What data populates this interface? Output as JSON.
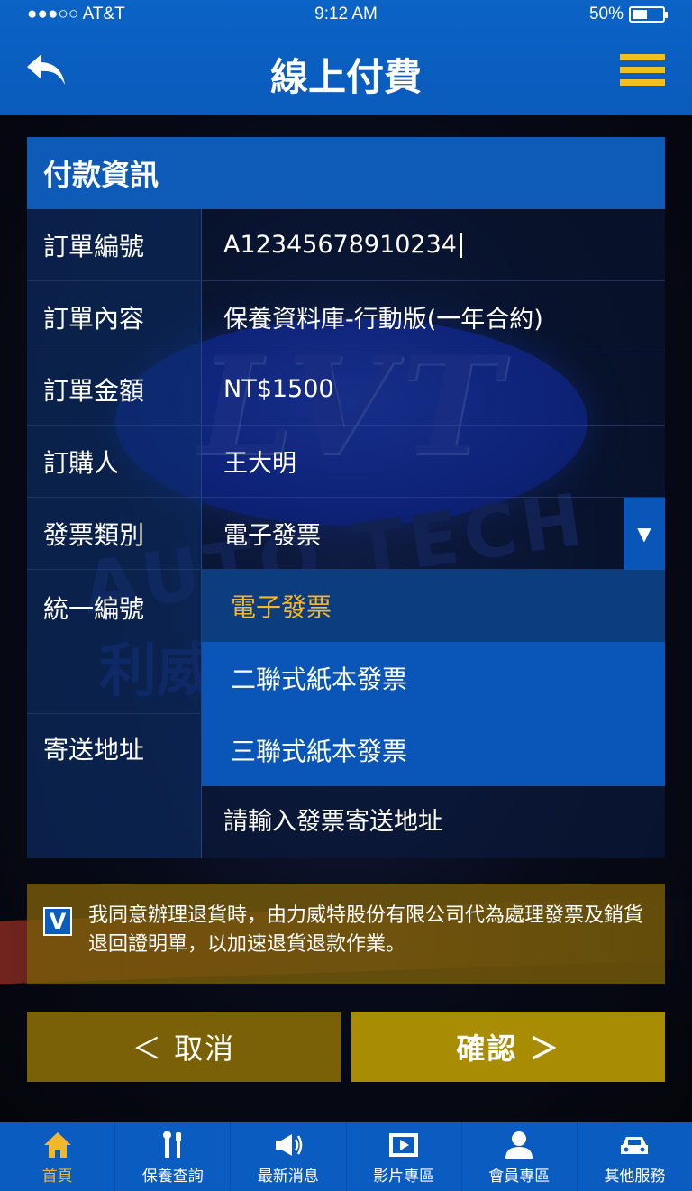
{
  "status_bar": {
    "carrier": "●●●○○ AT&T",
    "time": "9:12 AM",
    "battery": "50%",
    "battery_level": 0.5
  },
  "header": {
    "title": "線上付費",
    "back_icon": "back-arrow-icon",
    "menu_icon": "hamburger-menu-icon"
  },
  "panel": {
    "title": "付款資訊",
    "rows": [
      {
        "label": "訂單編號",
        "value": "A12345678910234"
      },
      {
        "label": "訂單內容",
        "value": "保養資料庫-行動版(一年合約)"
      },
      {
        "label": "訂單金額",
        "value": "NT$1500"
      },
      {
        "label": "訂購人",
        "value": "王大明"
      },
      {
        "label": "發票類別",
        "value": "電子發票"
      },
      {
        "label": "統一編號",
        "value": ""
      },
      {
        "label": "寄送地址",
        "value": "請輸入發票寄送地址"
      }
    ]
  },
  "invoice_dropdown": {
    "options": [
      "電子發票",
      "二聯式紙本發票",
      "三聯式紙本發票"
    ],
    "selected": "電子發票"
  },
  "agreement": {
    "checked": true,
    "check_mark": "V",
    "text": "我同意辦理退貨時，由力威特股份有限公司代為處理發票及銷貨退回證明單，以加速退貨退款作業。"
  },
  "buttons": {
    "cancel": "＜ 取消",
    "confirm": "確認 ＞"
  },
  "tabbar": {
    "items": [
      {
        "label": "首頁",
        "icon": "home-icon",
        "active": true
      },
      {
        "label": "保養查詢",
        "icon": "tools-icon",
        "active": false
      },
      {
        "label": "最新消息",
        "icon": "megaphone-icon",
        "active": false
      },
      {
        "label": "影片專區",
        "icon": "video-icon",
        "active": false
      },
      {
        "label": "會員專區",
        "icon": "user-icon",
        "active": false
      },
      {
        "label": "其他服務",
        "icon": "car-icon",
        "active": false
      }
    ]
  },
  "colors": {
    "header_blue": "#0b63c6",
    "accent_gold": "#f3b62c",
    "cancel_bg": "#7a6107",
    "confirm_bg": "#a88d04"
  }
}
